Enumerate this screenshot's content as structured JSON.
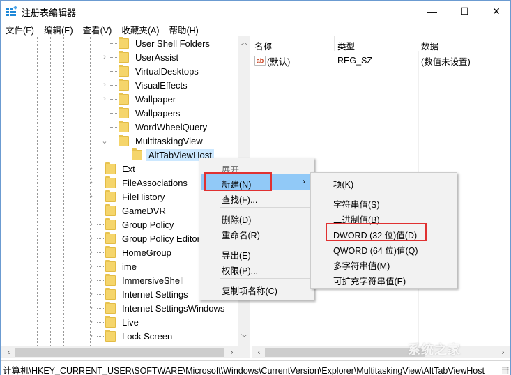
{
  "window": {
    "title": "注册表编辑器",
    "controls": {
      "minimize": "—",
      "maximize": "☐",
      "close": "✕"
    }
  },
  "menubar": {
    "items": [
      "文件(F)",
      "编辑(E)",
      "查看(V)",
      "收藏夹(A)",
      "帮助(H)"
    ]
  },
  "tree": {
    "items": [
      {
        "label": "User Shell Folders",
        "expander": ""
      },
      {
        "label": "UserAssist",
        "expander": ">"
      },
      {
        "label": "VirtualDesktops",
        "expander": ""
      },
      {
        "label": "VisualEffects",
        "expander": ">"
      },
      {
        "label": "Wallpaper",
        "expander": ">"
      },
      {
        "label": "Wallpapers",
        "expander": ""
      },
      {
        "label": "WordWheelQuery",
        "expander": ""
      },
      {
        "label": "MultitaskingView",
        "expander": "v"
      },
      {
        "label": "AltTabViewHost",
        "expander": "",
        "selected": true
      },
      {
        "label": "Ext",
        "expander": ">"
      },
      {
        "label": "FileAssociations",
        "expander": ">"
      },
      {
        "label": "FileHistory",
        "expander": ">"
      },
      {
        "label": "GameDVR",
        "expander": ""
      },
      {
        "label": "Group Policy",
        "expander": ">"
      },
      {
        "label": "Group Policy Editor",
        "expander": ">"
      },
      {
        "label": "HomeGroup",
        "expander": ">"
      },
      {
        "label": "ime",
        "expander": ">"
      },
      {
        "label": "ImmersiveShell",
        "expander": ">"
      },
      {
        "label": "Internet Settings",
        "expander": ">"
      },
      {
        "label": "Internet SettingsWindows",
        "expander": ">"
      },
      {
        "label": "Live",
        "expander": ">"
      },
      {
        "label": "Lock Screen",
        "expander": ">"
      }
    ]
  },
  "list": {
    "headers": {
      "name": "名称",
      "type": "类型",
      "data": "数据"
    },
    "rows": [
      {
        "icon": "ab",
        "name": "(默认)",
        "type": "REG_SZ",
        "data": "(数值未设置)"
      }
    ]
  },
  "context_menu": {
    "items": [
      {
        "label": "展开",
        "disabled": true
      },
      {
        "label": "新建(N)",
        "hover": true,
        "submenu": true,
        "highlighted": true
      },
      {
        "label": "查找(F)..."
      },
      {
        "label": "删除(D)"
      },
      {
        "label": "重命名(R)"
      },
      {
        "label": "导出(E)"
      },
      {
        "label": "权限(P)..."
      },
      {
        "label": "复制项名称(C)"
      }
    ]
  },
  "submenu": {
    "items": [
      {
        "label": "项(K)"
      },
      {
        "label": "字符串值(S)"
      },
      {
        "label": "二进制值(B)"
      },
      {
        "label": "DWORD (32 位)值(D)",
        "highlighted": true
      },
      {
        "label": "QWORD (64 位)值(Q)"
      },
      {
        "label": "多字符串值(M)"
      },
      {
        "label": "可扩充字符串值(E)"
      }
    ]
  },
  "statusbar": {
    "path": "计算机\\HKEY_CURRENT_USER\\SOFTWARE\\Microsoft\\Windows\\CurrentVersion\\Explorer\\MultitaskingView\\AltTabViewHost"
  },
  "watermark": "系统之家",
  "colors": {
    "highlight_box": "#e03131",
    "menu_hover": "#91c9f7",
    "selection": "#cce8ff",
    "folder": "#f5d56b"
  }
}
